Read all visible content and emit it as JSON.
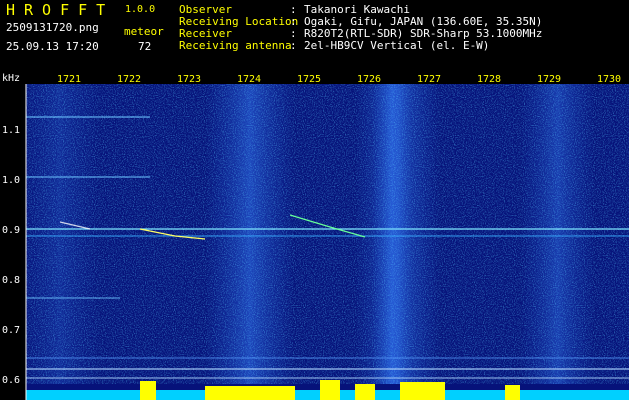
{
  "app": {
    "title": "HROFFT",
    "version": "1.0.0"
  },
  "capture": {
    "file": "2509131720.png",
    "timestamp": "25.09.13 17:20",
    "mode": "meteor",
    "count": "72"
  },
  "info": [
    {
      "key": "Observer",
      "value": "Takanori Kawachi"
    },
    {
      "key": "Receiving Location",
      "value": "Ogaki, Gifu, JAPAN (136.60E, 35.35N)"
    },
    {
      "key": "Receiver",
      "value": "R820T2(RTL-SDR) SDR-Sharp 53.1000MHz"
    },
    {
      "key": "Receiving antenna",
      "value": "2el-HB9CV Vertical (el. E-W)"
    }
  ],
  "axis": {
    "unit": "kHz",
    "freq_ticks": [
      "1.1",
      "1.0",
      "0.9",
      "0.8",
      "0.7",
      "0.6"
    ],
    "time_ticks": [
      "1721",
      "1722",
      "1723",
      "1724",
      "1725",
      "1726",
      "1727",
      "1728",
      "1729",
      "1730"
    ]
  },
  "colors": {
    "background": "#000000",
    "label": "#ffff00",
    "text": "#ffffff",
    "signal_low": "#0a1a8a",
    "signal_high": "#00ffff"
  }
}
